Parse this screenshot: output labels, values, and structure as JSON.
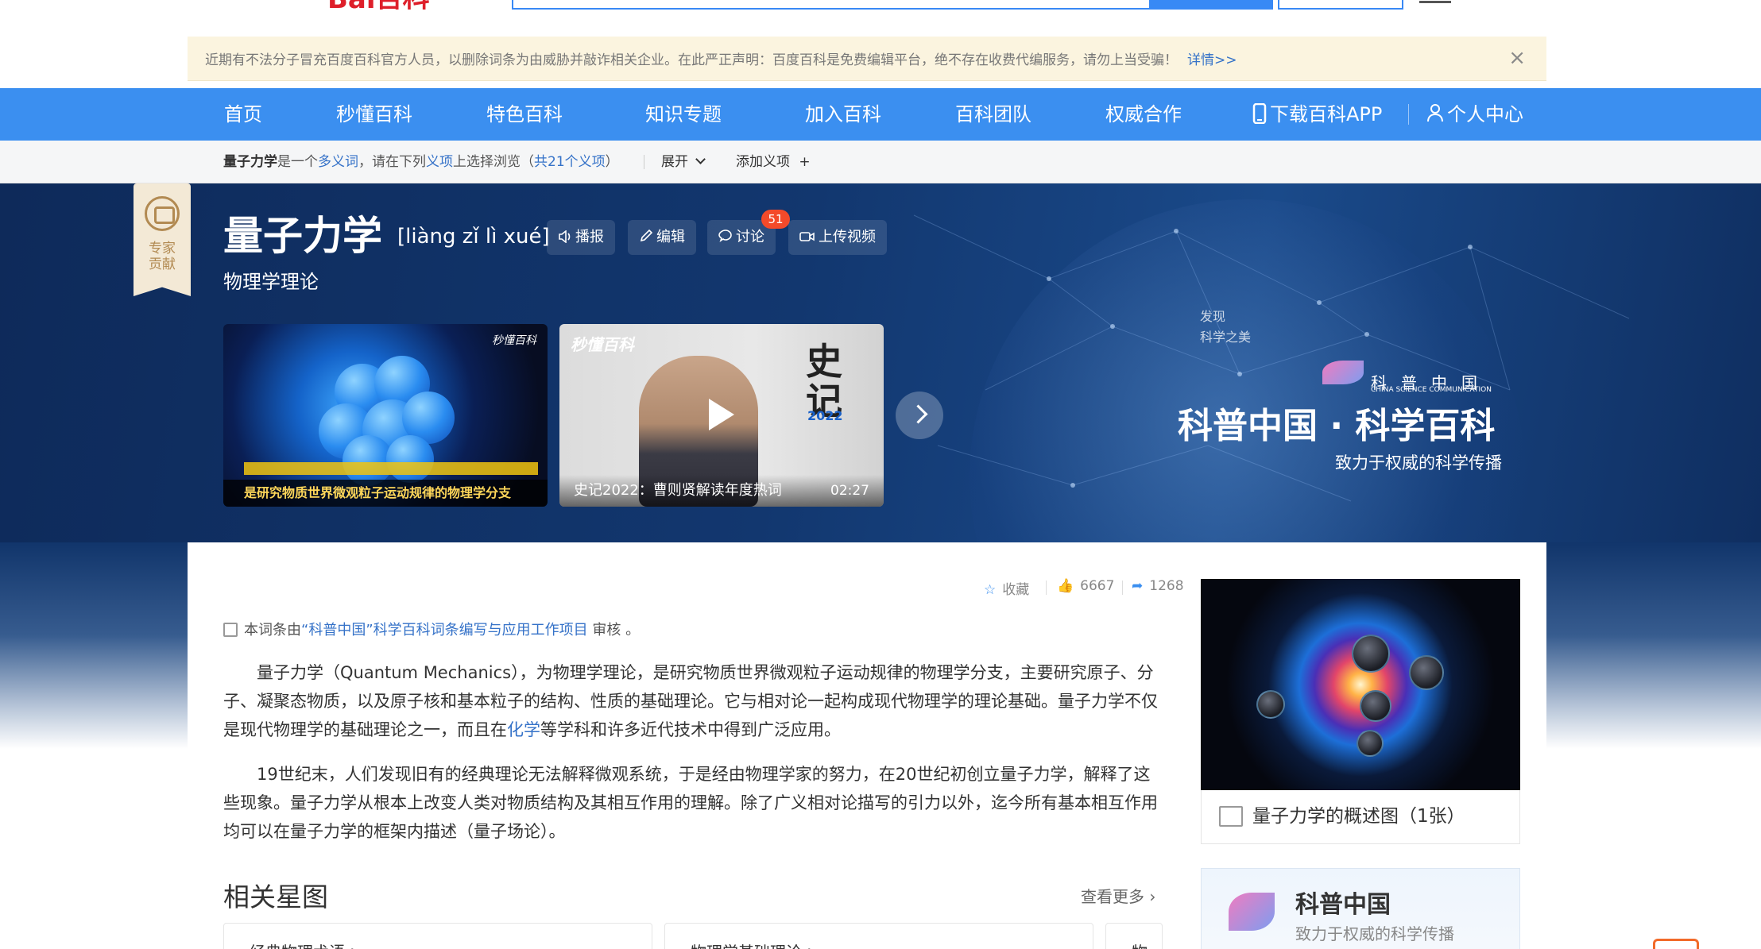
{
  "header": {
    "logo_text": "Bai百科",
    "search_placeholder": ""
  },
  "notice": {
    "text": "近期有不法分子冒充百度百科官方人员，以删除词条为由威胁并敲诈相关企业。在此严正声明：百度百科是免费编辑平台，绝不存在收费代编服务，请勿上当受骗！",
    "more_label": "详情>>",
    "close_label": "×"
  },
  "nav": {
    "items": [
      "首页",
      "秒懂百科",
      "特色百科",
      "知识专题",
      "加入百科",
      "百科团队",
      "权威合作"
    ],
    "download_app": "下载百科APP",
    "personal_center": "个人中心"
  },
  "polysemy": {
    "term": "量子力学",
    "text_is": "是一个",
    "link_polysemy": "多义词",
    "text_please": "，请在下列",
    "link_meaning": "义项",
    "text_browse": "上选择浏览（",
    "link_count": "共21个义项",
    "text_close": "）",
    "expand_label": "展开",
    "add_meaning_label": "添加义项"
  },
  "hero": {
    "expert_badge_text": "专家贡献",
    "title": "量子力学",
    "pinyin": "[liàng zǐ lì xué]",
    "buttons": {
      "broadcast": "播报",
      "edit": "编辑",
      "discuss": "讨论",
      "upload_video": "上传视频"
    },
    "discuss_count": "51",
    "subtitle": "物理学理论",
    "video1": {
      "brand": "秒懂百科",
      "caption": "是研究物质世界微观粒子运动规律的物理学分支"
    },
    "video2": {
      "brand": "秒懂百科",
      "shiji": "史记",
      "year": "2022",
      "caption": "史记2022：曹则贤解读年度热词",
      "duration": "02:27"
    },
    "promo": {
      "small_line1": "发现",
      "small_line2": "科学之美",
      "logo_cn": "科普中国",
      "logo_en": "CHINA SCIENCE COMMUNICATION",
      "title": "科普中国 · 科学百科",
      "slogan": "致力于权威的科学传播"
    }
  },
  "stats": {
    "favorite_label": "收藏",
    "likes": "6667",
    "shares": "1268"
  },
  "review": {
    "prefix": "本词条由",
    "link": "“科普中国”科学百科词条编写与应用工作项目",
    "suffix": " 审核 。"
  },
  "content": {
    "para1_a": "量子力学（Quantum Mechanics），为物理学理论，是研究物质世界微观粒子运动规律的物理学分支，主要研究原子、分子、凝聚态物质，以及原子核和基本粒子的结构、性质的基础理论。它与相对论一起构成现代物理学的理论基础。量子力学不仅是现代物理学的基础理论之一，而且在",
    "para1_link": "化学",
    "para1_b": "等学科和许多近代技术中得到广泛应用。",
    "para2": "19世纪末，人们发现旧有的经典理论无法解释微观系统，于是经由物理学家的努力，在20世纪初创立量子力学，解释了这些现象。量子力学从根本上改变人类对物质结构及其相互作用的理解。除了广义相对论描写的引力以外，迄今所有基本相互作用均可以在量子力学的框架内描述（量子场论）。"
  },
  "related": {
    "title": "相关星图",
    "see_more": "查看更多",
    "cards": [
      "经典物理术语 >",
      "物理学基础理论 >",
      "物理"
    ]
  },
  "sidebar": {
    "image_caption": "量子力学的概述图（1张）",
    "kp_title": "科普中国",
    "kp_slogan": "致力于权威的科学传播"
  }
}
